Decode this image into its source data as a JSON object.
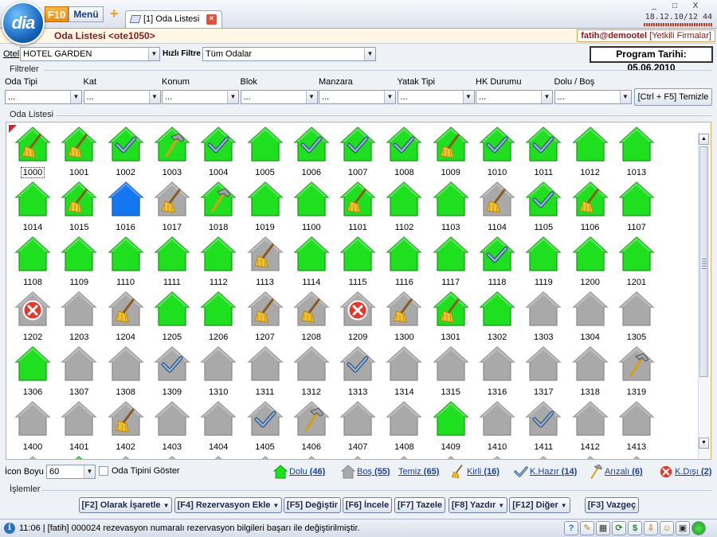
{
  "app": {
    "logo_text": "dia",
    "f10_label": "F10",
    "menu_label": "Menü",
    "tab_label": "[1] Oda Listesi",
    "clock": "18.12.10/12 44",
    "window_controls": [
      "_",
      "□",
      "X"
    ]
  },
  "header": {
    "page_title": "Oda Listesi <ote1050>",
    "user": "fatih@demootel",
    "authorized_companies": "[Yetkili Firmalar]"
  },
  "hotel": {
    "label": "Otel",
    "value": "HOTEL GARDEN",
    "quick_filter_label": "Hızlı Filtre",
    "quick_filter_value": "Tüm Odalar",
    "program_date": "Program Tarihi: 05.06.2010"
  },
  "filters": {
    "title": "Filtreler",
    "fields": [
      {
        "label": "Oda Tipi",
        "value": "..."
      },
      {
        "label": "Kat",
        "value": "..."
      },
      {
        "label": "Konum",
        "value": "..."
      },
      {
        "label": "Blok",
        "value": "..."
      },
      {
        "label": "Manzara",
        "value": "..."
      },
      {
        "label": "Yatak Tipi",
        "value": "..."
      },
      {
        "label": "HK Durumu",
        "value": "..."
      },
      {
        "label": "Dolu / Boş",
        "value": "..."
      }
    ],
    "clear_button": "[Ctrl + F5] Temizle"
  },
  "room_list": {
    "title": "Oda Listesi",
    "rooms": [
      {
        "no": "1000",
        "occ": "dolu",
        "st": "kirli"
      },
      {
        "no": "1001",
        "occ": "dolu",
        "st": "kirli"
      },
      {
        "no": "1002",
        "occ": "dolu",
        "st": "hazir"
      },
      {
        "no": "1003",
        "occ": "dolu",
        "st": "arizali"
      },
      {
        "no": "1004",
        "occ": "dolu",
        "st": "hazir"
      },
      {
        "no": "1005",
        "occ": "dolu",
        "st": "temiz"
      },
      {
        "no": "1006",
        "occ": "dolu",
        "st": "hazir"
      },
      {
        "no": "1007",
        "occ": "dolu",
        "st": "hazir"
      },
      {
        "no": "1008",
        "occ": "dolu",
        "st": "hazir"
      },
      {
        "no": "1009",
        "occ": "dolu",
        "st": "kirli"
      },
      {
        "no": "1010",
        "occ": "dolu",
        "st": "hazir"
      },
      {
        "no": "1011",
        "occ": "dolu",
        "st": "hazir"
      },
      {
        "no": "1012",
        "occ": "dolu",
        "st": "temiz"
      },
      {
        "no": "1013",
        "occ": "dolu",
        "st": "temiz"
      },
      {
        "no": "1014",
        "occ": "dolu",
        "st": "temiz"
      },
      {
        "no": "1015",
        "occ": "dolu",
        "st": "kirli"
      },
      {
        "no": "1016",
        "occ": "mavi",
        "st": "temiz"
      },
      {
        "no": "1017",
        "occ": "bos",
        "st": "kirli"
      },
      {
        "no": "1018",
        "occ": "dolu",
        "st": "arizali"
      },
      {
        "no": "1019",
        "occ": "dolu",
        "st": "temiz"
      },
      {
        "no": "1100",
        "occ": "dolu",
        "st": "temiz"
      },
      {
        "no": "1101",
        "occ": "dolu",
        "st": "kirli"
      },
      {
        "no": "1102",
        "occ": "dolu",
        "st": "temiz"
      },
      {
        "no": "1103",
        "occ": "dolu",
        "st": "temiz"
      },
      {
        "no": "1104",
        "occ": "bos",
        "st": "kirli"
      },
      {
        "no": "1105",
        "occ": "dolu",
        "st": "hazir"
      },
      {
        "no": "1106",
        "occ": "dolu",
        "st": "kirli"
      },
      {
        "no": "1107",
        "occ": "dolu",
        "st": "temiz"
      },
      {
        "no": "1108",
        "occ": "dolu",
        "st": "temiz"
      },
      {
        "no": "1109",
        "occ": "dolu",
        "st": "temiz"
      },
      {
        "no": "1110",
        "occ": "dolu",
        "st": "temiz"
      },
      {
        "no": "1111",
        "occ": "dolu",
        "st": "temiz"
      },
      {
        "no": "1112",
        "occ": "dolu",
        "st": "temiz"
      },
      {
        "no": "1113",
        "occ": "bos",
        "st": "kirli"
      },
      {
        "no": "1114",
        "occ": "dolu",
        "st": "temiz"
      },
      {
        "no": "1115",
        "occ": "dolu",
        "st": "temiz"
      },
      {
        "no": "1116",
        "occ": "dolu",
        "st": "temiz"
      },
      {
        "no": "1117",
        "occ": "dolu",
        "st": "temiz"
      },
      {
        "no": "1118",
        "occ": "dolu",
        "st": "hazir"
      },
      {
        "no": "1119",
        "occ": "dolu",
        "st": "temiz"
      },
      {
        "no": "1200",
        "occ": "dolu",
        "st": "temiz"
      },
      {
        "no": "1201",
        "occ": "dolu",
        "st": "temiz"
      },
      {
        "no": "1202",
        "occ": "bos",
        "st": "kdisi"
      },
      {
        "no": "1203",
        "occ": "bos",
        "st": "temiz"
      },
      {
        "no": "1204",
        "occ": "bos",
        "st": "kirli"
      },
      {
        "no": "1205",
        "occ": "dolu",
        "st": "temiz"
      },
      {
        "no": "1206",
        "occ": "dolu",
        "st": "temiz"
      },
      {
        "no": "1207",
        "occ": "bos",
        "st": "kirli"
      },
      {
        "no": "1208",
        "occ": "bos",
        "st": "kirli"
      },
      {
        "no": "1209",
        "occ": "bos",
        "st": "kdisi"
      },
      {
        "no": "1300",
        "occ": "bos",
        "st": "kirli"
      },
      {
        "no": "1301",
        "occ": "dolu",
        "st": "kirli"
      },
      {
        "no": "1302",
        "occ": "dolu",
        "st": "temiz"
      },
      {
        "no": "1303",
        "occ": "bos",
        "st": "temiz"
      },
      {
        "no": "1304",
        "occ": "bos",
        "st": "temiz"
      },
      {
        "no": "1305",
        "occ": "bos",
        "st": "temiz"
      },
      {
        "no": "1306",
        "occ": "dolu",
        "st": "temiz"
      },
      {
        "no": "1307",
        "occ": "bos",
        "st": "temiz"
      },
      {
        "no": "1308",
        "occ": "bos",
        "st": "temiz"
      },
      {
        "no": "1309",
        "occ": "bos",
        "st": "hazir"
      },
      {
        "no": "1310",
        "occ": "bos",
        "st": "temiz"
      },
      {
        "no": "1311",
        "occ": "bos",
        "st": "temiz"
      },
      {
        "no": "1312",
        "occ": "bos",
        "st": "temiz"
      },
      {
        "no": "1313",
        "occ": "bos",
        "st": "hazir"
      },
      {
        "no": "1314",
        "occ": "bos",
        "st": "temiz"
      },
      {
        "no": "1315",
        "occ": "bos",
        "st": "temiz"
      },
      {
        "no": "1316",
        "occ": "bos",
        "st": "temiz"
      },
      {
        "no": "1317",
        "occ": "bos",
        "st": "temiz"
      },
      {
        "no": "1318",
        "occ": "bos",
        "st": "temiz"
      },
      {
        "no": "1319",
        "occ": "bos",
        "st": "arizali"
      },
      {
        "no": "1400",
        "occ": "bos",
        "st": "temiz"
      },
      {
        "no": "1401",
        "occ": "bos",
        "st": "temiz"
      },
      {
        "no": "1402",
        "occ": "bos",
        "st": "kirli"
      },
      {
        "no": "1403",
        "occ": "bos",
        "st": "temiz"
      },
      {
        "no": "1404",
        "occ": "bos",
        "st": "temiz"
      },
      {
        "no": "1405",
        "occ": "bos",
        "st": "hazir"
      },
      {
        "no": "1406",
        "occ": "bos",
        "st": "arizali"
      },
      {
        "no": "1407",
        "occ": "bos",
        "st": "temiz"
      },
      {
        "no": "1408",
        "occ": "bos",
        "st": "temiz"
      },
      {
        "no": "1409",
        "occ": "dolu",
        "st": "temiz"
      },
      {
        "no": "1410",
        "occ": "bos",
        "st": "temiz"
      },
      {
        "no": "1411",
        "occ": "bos",
        "st": "hazir"
      },
      {
        "no": "1412",
        "occ": "bos",
        "st": "temiz"
      },
      {
        "no": "1413",
        "occ": "bos",
        "st": "temiz"
      }
    ],
    "partial_row": [
      {
        "occ": "bos"
      },
      {
        "occ": "dolu"
      },
      {
        "occ": "bos"
      },
      {
        "occ": "bos"
      },
      {
        "occ": "bos"
      },
      {
        "occ": "bos"
      },
      {
        "occ": "bos"
      },
      {
        "occ": "bos"
      },
      {
        "occ": "bos"
      },
      {
        "occ": "bos"
      },
      {
        "occ": "bos"
      },
      {
        "occ": "bos"
      },
      {
        "occ": "bos"
      },
      {
        "occ": "bos"
      }
    ]
  },
  "legend": {
    "icon_size_label": "İcon Boyu",
    "icon_size_value": "60",
    "show_room_type_label": "Oda Tipini Göster",
    "items": [
      {
        "icon": "green-house-icon",
        "text": "Dolu",
        "count": "(46)"
      },
      {
        "icon": "gray-house-icon",
        "text": "Boş",
        "count": "(55)"
      },
      {
        "icon": "none",
        "text": "Temiz",
        "count": "(65)"
      },
      {
        "icon": "broom-icon",
        "text": "Kirli",
        "count": "(16)"
      },
      {
        "icon": "checkmark-icon",
        "text": "K.Hazır",
        "count": "(14)"
      },
      {
        "icon": "hammer-icon",
        "text": "Arızalı",
        "count": "(6)"
      },
      {
        "icon": "out-of-order-icon",
        "text": "K.Dışı",
        "count": "(2)"
      }
    ]
  },
  "actions": {
    "title": "İşlemler",
    "buttons": [
      {
        "label": "[F2] Olarak İşaretle",
        "dropdown": true
      },
      {
        "label": "[F4] Rezervasyon Ekle",
        "dropdown": true
      },
      {
        "label": "[F5] Değiştir",
        "dropdown": false
      },
      {
        "label": "[F6] İncele",
        "dropdown": false
      },
      {
        "label": "[F7] Tazele",
        "dropdown": false
      },
      {
        "label": "[F8] Yazdır",
        "dropdown": true
      },
      {
        "label": "[F12] Diğer",
        "dropdown": true
      },
      {
        "label": "[F3] Vazgeç",
        "dropdown": false
      }
    ]
  },
  "status": {
    "text": "11:06 | [fatih] 000024 rezevasyon numaralı rezervasyon bilgileri başarı ile değiştirilmiştir."
  },
  "colors": {
    "occupied_green": "#1ee01e",
    "vacant_gray": "#a9a9a9",
    "blue_house": "#1577f0",
    "title_red": "#8b1a1a",
    "link_blue": "#1a3fa3"
  }
}
